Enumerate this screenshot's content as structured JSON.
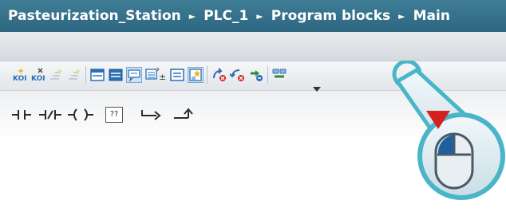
{
  "breadcrumb": {
    "project": "Pasteurization_Station",
    "device": "PLC_1",
    "folder": "Program blocks",
    "block": "Main",
    "separator": "►"
  },
  "toolbar": {
    "icons": [
      "insert-network-icon",
      "delete-network-icon",
      "insert-row-icon",
      "append-row-icon",
      "collapse-all-icon",
      "expand-all-icon",
      "comments-icon",
      "absolute-symbolic-icon",
      "networks-list-icon",
      "favorites-icon",
      "go-to-next-error-icon",
      "go-to-previous-error-icon",
      "update-calls-icon",
      "monitoring-icon"
    ],
    "highlighted": "monitoring-icon"
  },
  "ladder": {
    "labels": [
      "⊣⊢",
      "⊣/⊢",
      "–()–",
      "??",
      "↦",
      "↗"
    ],
    "box_label": "??"
  },
  "callout": {
    "accent": "#4ab5c8",
    "mouse_button_color": "#1f5fa0",
    "arrow_color": "#d62020"
  }
}
